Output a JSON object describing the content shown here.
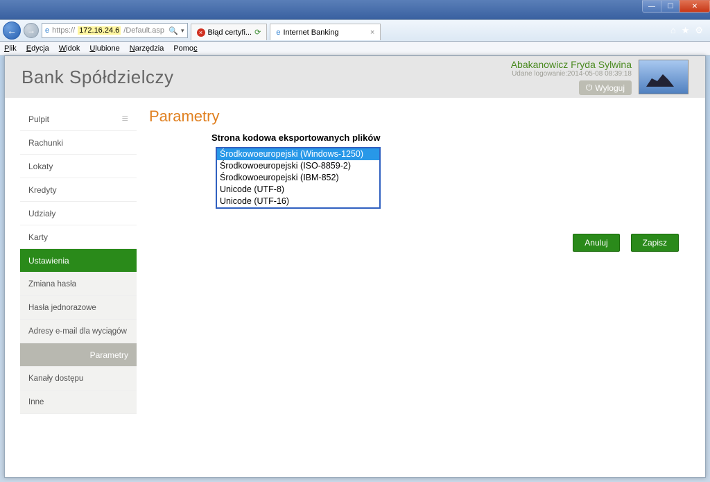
{
  "window": {
    "address_scheme": "https://",
    "address_ip": "172.16.24.6",
    "address_path": "/Default.asp",
    "cert_tab": "Błąd certyfi...",
    "page_tab": "Internet Banking",
    "menu": {
      "plik": "Plik",
      "edycja": "Edycja",
      "widok": "Widok",
      "ulubione": "Ulubione",
      "narzedzia": "Narzędzia",
      "pomoc": "Pomoc"
    }
  },
  "header": {
    "bank": "Bank Spółdzielczy",
    "user": "Abakanowicz Fryda Sylwina",
    "login_time": "Udane logowanie:2014-05-08 08:39:18",
    "logout": "Wyloguj"
  },
  "sidebar": {
    "pulpit": "Pulpit",
    "rachunki": "Rachunki",
    "lokaty": "Lokaty",
    "kredyty": "Kredyty",
    "udzialy": "Udziały",
    "karty": "Karty",
    "ustawienia": "Ustawienia",
    "zmiana": "Zmiana hasła",
    "hasla": "Hasła jednorazowe",
    "adresy": "Adresy e-mail dla wyciągów",
    "parametry": "Parametry",
    "kanaly": "Kanały dostępu",
    "inne": "Inne"
  },
  "main": {
    "title": "Parametry",
    "label": "Strona kodowa eksportowanych plików",
    "options": {
      "o1": "Środkowoeuropejski (Windows-1250)",
      "o2": "Środkowoeuropejski (ISO-8859-2)",
      "o3": "Środkowoeuropejski (IBM-852)",
      "o4": "Unicode (UTF-8)",
      "o5": "Unicode (UTF-16)"
    },
    "cancel": "Anuluj",
    "save": "Zapisz"
  }
}
